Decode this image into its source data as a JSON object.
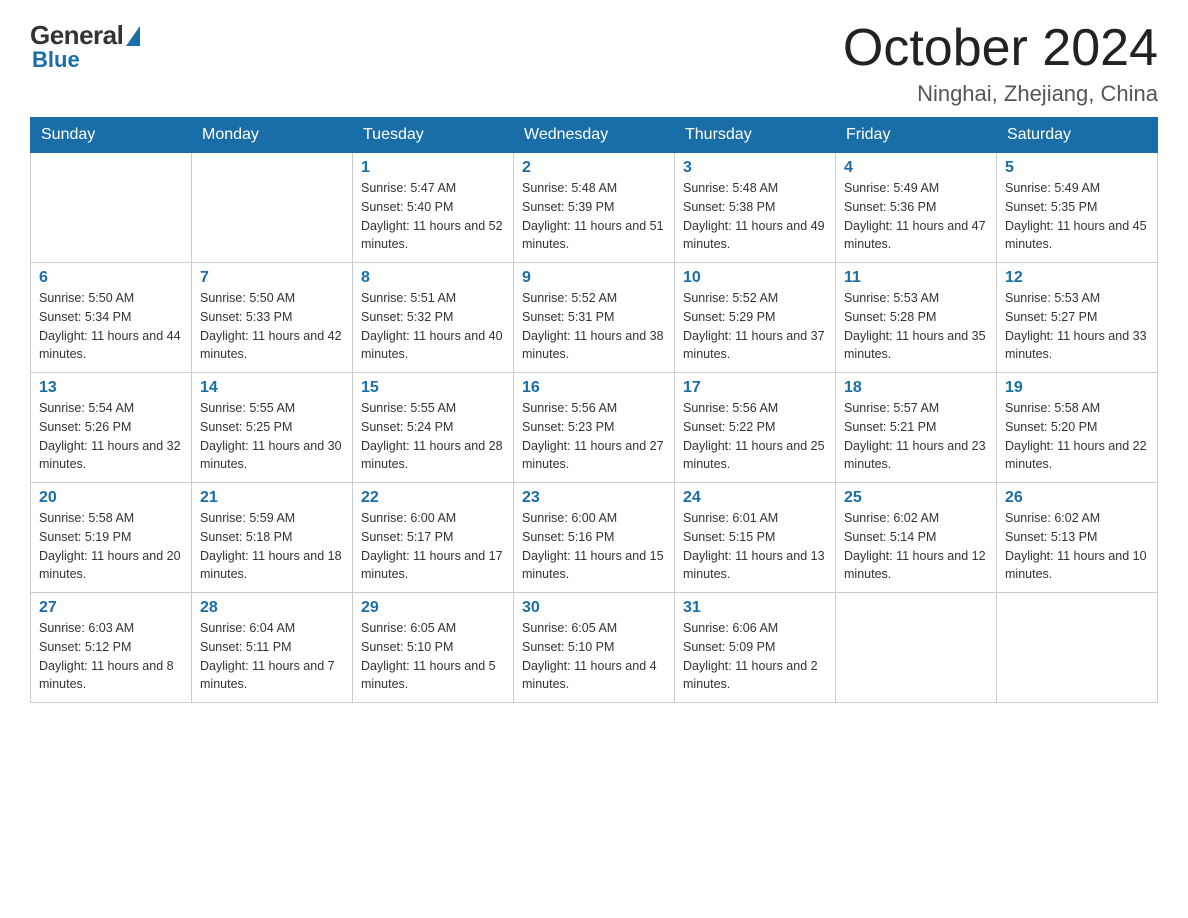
{
  "header": {
    "logo": {
      "general": "General",
      "blue": "Blue",
      "bottom": "Blue"
    },
    "title": "October 2024",
    "location": "Ninghai, Zhejiang, China"
  },
  "days_of_week": [
    "Sunday",
    "Monday",
    "Tuesday",
    "Wednesday",
    "Thursday",
    "Friday",
    "Saturday"
  ],
  "weeks": [
    [
      {
        "day": "",
        "sunrise": "",
        "sunset": "",
        "daylight": ""
      },
      {
        "day": "",
        "sunrise": "",
        "sunset": "",
        "daylight": ""
      },
      {
        "day": "1",
        "sunrise": "Sunrise: 5:47 AM",
        "sunset": "Sunset: 5:40 PM",
        "daylight": "Daylight: 11 hours and 52 minutes."
      },
      {
        "day": "2",
        "sunrise": "Sunrise: 5:48 AM",
        "sunset": "Sunset: 5:39 PM",
        "daylight": "Daylight: 11 hours and 51 minutes."
      },
      {
        "day": "3",
        "sunrise": "Sunrise: 5:48 AM",
        "sunset": "Sunset: 5:38 PM",
        "daylight": "Daylight: 11 hours and 49 minutes."
      },
      {
        "day": "4",
        "sunrise": "Sunrise: 5:49 AM",
        "sunset": "Sunset: 5:36 PM",
        "daylight": "Daylight: 11 hours and 47 minutes."
      },
      {
        "day": "5",
        "sunrise": "Sunrise: 5:49 AM",
        "sunset": "Sunset: 5:35 PM",
        "daylight": "Daylight: 11 hours and 45 minutes."
      }
    ],
    [
      {
        "day": "6",
        "sunrise": "Sunrise: 5:50 AM",
        "sunset": "Sunset: 5:34 PM",
        "daylight": "Daylight: 11 hours and 44 minutes."
      },
      {
        "day": "7",
        "sunrise": "Sunrise: 5:50 AM",
        "sunset": "Sunset: 5:33 PM",
        "daylight": "Daylight: 11 hours and 42 minutes."
      },
      {
        "day": "8",
        "sunrise": "Sunrise: 5:51 AM",
        "sunset": "Sunset: 5:32 PM",
        "daylight": "Daylight: 11 hours and 40 minutes."
      },
      {
        "day": "9",
        "sunrise": "Sunrise: 5:52 AM",
        "sunset": "Sunset: 5:31 PM",
        "daylight": "Daylight: 11 hours and 38 minutes."
      },
      {
        "day": "10",
        "sunrise": "Sunrise: 5:52 AM",
        "sunset": "Sunset: 5:29 PM",
        "daylight": "Daylight: 11 hours and 37 minutes."
      },
      {
        "day": "11",
        "sunrise": "Sunrise: 5:53 AM",
        "sunset": "Sunset: 5:28 PM",
        "daylight": "Daylight: 11 hours and 35 minutes."
      },
      {
        "day": "12",
        "sunrise": "Sunrise: 5:53 AM",
        "sunset": "Sunset: 5:27 PM",
        "daylight": "Daylight: 11 hours and 33 minutes."
      }
    ],
    [
      {
        "day": "13",
        "sunrise": "Sunrise: 5:54 AM",
        "sunset": "Sunset: 5:26 PM",
        "daylight": "Daylight: 11 hours and 32 minutes."
      },
      {
        "day": "14",
        "sunrise": "Sunrise: 5:55 AM",
        "sunset": "Sunset: 5:25 PM",
        "daylight": "Daylight: 11 hours and 30 minutes."
      },
      {
        "day": "15",
        "sunrise": "Sunrise: 5:55 AM",
        "sunset": "Sunset: 5:24 PM",
        "daylight": "Daylight: 11 hours and 28 minutes."
      },
      {
        "day": "16",
        "sunrise": "Sunrise: 5:56 AM",
        "sunset": "Sunset: 5:23 PM",
        "daylight": "Daylight: 11 hours and 27 minutes."
      },
      {
        "day": "17",
        "sunrise": "Sunrise: 5:56 AM",
        "sunset": "Sunset: 5:22 PM",
        "daylight": "Daylight: 11 hours and 25 minutes."
      },
      {
        "day": "18",
        "sunrise": "Sunrise: 5:57 AM",
        "sunset": "Sunset: 5:21 PM",
        "daylight": "Daylight: 11 hours and 23 minutes."
      },
      {
        "day": "19",
        "sunrise": "Sunrise: 5:58 AM",
        "sunset": "Sunset: 5:20 PM",
        "daylight": "Daylight: 11 hours and 22 minutes."
      }
    ],
    [
      {
        "day": "20",
        "sunrise": "Sunrise: 5:58 AM",
        "sunset": "Sunset: 5:19 PM",
        "daylight": "Daylight: 11 hours and 20 minutes."
      },
      {
        "day": "21",
        "sunrise": "Sunrise: 5:59 AM",
        "sunset": "Sunset: 5:18 PM",
        "daylight": "Daylight: 11 hours and 18 minutes."
      },
      {
        "day": "22",
        "sunrise": "Sunrise: 6:00 AM",
        "sunset": "Sunset: 5:17 PM",
        "daylight": "Daylight: 11 hours and 17 minutes."
      },
      {
        "day": "23",
        "sunrise": "Sunrise: 6:00 AM",
        "sunset": "Sunset: 5:16 PM",
        "daylight": "Daylight: 11 hours and 15 minutes."
      },
      {
        "day": "24",
        "sunrise": "Sunrise: 6:01 AM",
        "sunset": "Sunset: 5:15 PM",
        "daylight": "Daylight: 11 hours and 13 minutes."
      },
      {
        "day": "25",
        "sunrise": "Sunrise: 6:02 AM",
        "sunset": "Sunset: 5:14 PM",
        "daylight": "Daylight: 11 hours and 12 minutes."
      },
      {
        "day": "26",
        "sunrise": "Sunrise: 6:02 AM",
        "sunset": "Sunset: 5:13 PM",
        "daylight": "Daylight: 11 hours and 10 minutes."
      }
    ],
    [
      {
        "day": "27",
        "sunrise": "Sunrise: 6:03 AM",
        "sunset": "Sunset: 5:12 PM",
        "daylight": "Daylight: 11 hours and 8 minutes."
      },
      {
        "day": "28",
        "sunrise": "Sunrise: 6:04 AM",
        "sunset": "Sunset: 5:11 PM",
        "daylight": "Daylight: 11 hours and 7 minutes."
      },
      {
        "day": "29",
        "sunrise": "Sunrise: 6:05 AM",
        "sunset": "Sunset: 5:10 PM",
        "daylight": "Daylight: 11 hours and 5 minutes."
      },
      {
        "day": "30",
        "sunrise": "Sunrise: 6:05 AM",
        "sunset": "Sunset: 5:10 PM",
        "daylight": "Daylight: 11 hours and 4 minutes."
      },
      {
        "day": "31",
        "sunrise": "Sunrise: 6:06 AM",
        "sunset": "Sunset: 5:09 PM",
        "daylight": "Daylight: 11 hours and 2 minutes."
      },
      {
        "day": "",
        "sunrise": "",
        "sunset": "",
        "daylight": ""
      },
      {
        "day": "",
        "sunrise": "",
        "sunset": "",
        "daylight": ""
      }
    ]
  ]
}
